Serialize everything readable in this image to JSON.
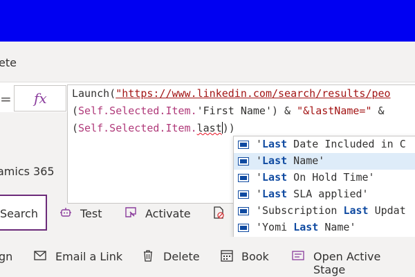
{
  "header": {
    "bar_color": "#0000f2"
  },
  "ribbon": {
    "partial_label": "ete"
  },
  "formula": {
    "fx_label": "fx",
    "line1_a": "Launch(",
    "line1_url": "\"https://www.linkedin.com/search/results/peo",
    "line2_a": "(",
    "line2_prop": "Self.Selected.Item.",
    "line2_b": "'First Name') & ",
    "line2_str": "\"&lastName=\"",
    "line2_c": " &",
    "line3_a": "(",
    "line3_prop": "Self.Selected.Item.",
    "line3_err": "last",
    "line3_b": "))"
  },
  "left_panel": {
    "partial_label": "amics 365"
  },
  "toolbar": {
    "search_label": "Search",
    "test_label": "Test",
    "activate_label": "Activate"
  },
  "autocomplete": {
    "items": [
      {
        "pre": "'",
        "hl": "Last",
        "post": " Date Included in C",
        "selected": false
      },
      {
        "pre": "'",
        "hl": "Last",
        "post": " Name'",
        "selected": true
      },
      {
        "pre": "'",
        "hl": "Last",
        "post": " On Hold Time'",
        "selected": false
      },
      {
        "pre": "'",
        "hl": "Last",
        "post": " SLA applied'",
        "selected": false
      },
      {
        "pre": "'Subscription ",
        "hl": "Last",
        "post": " Updat",
        "selected": false
      },
      {
        "pre": "'Yomi ",
        "hl": "Last",
        "post": " Name'",
        "selected": false
      }
    ]
  },
  "bottom_bar": {
    "partial_label": "gn",
    "email_label": "Email a Link",
    "delete_label": "Delete",
    "book_label": "Book",
    "open_stage_label": "Open Active Stage"
  }
}
